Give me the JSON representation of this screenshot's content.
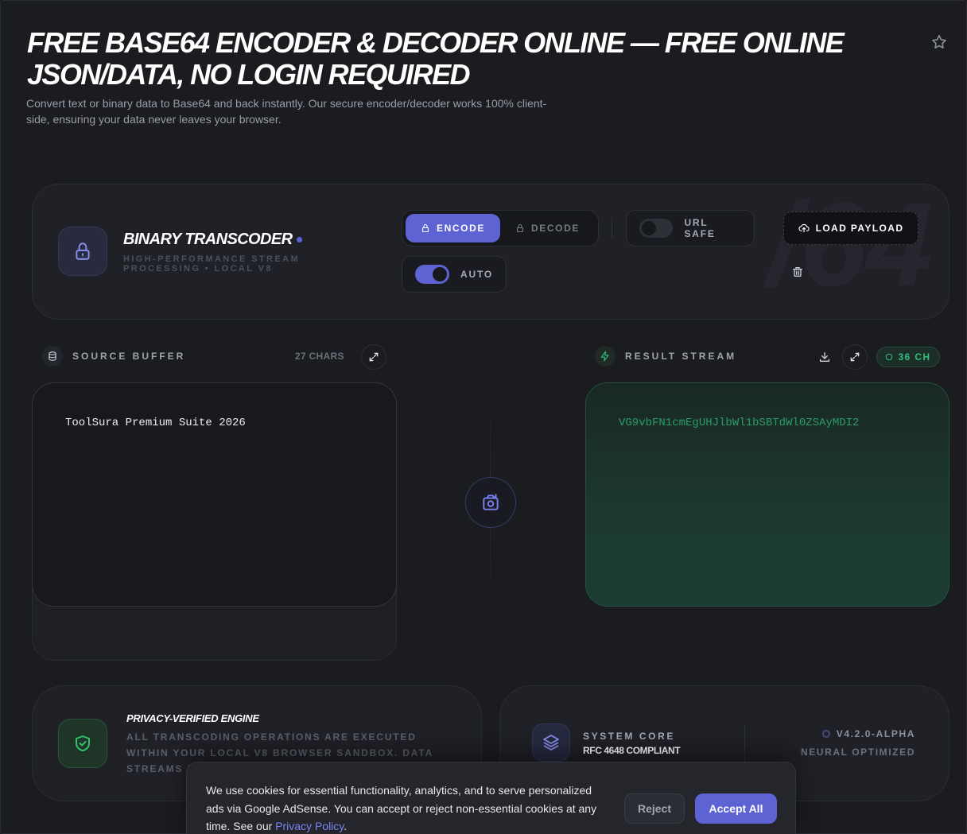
{
  "header": {
    "title": "FREE BASE64 ENCODER & DECODER ONLINE — FREE ONLINE JSON/DATA, NO LOGIN REQUIRED",
    "subtitle": "Convert text or binary data to Base64 and back instantly. Our secure encoder/decoder works 100% client-side, ensuring your data never leaves your browser."
  },
  "control": {
    "watermark": "/64",
    "brand_name": "BINARY TRANSCODER",
    "brand_sub": "HIGH-PERFORMANCE STREAM PROCESSING • LOCAL V8",
    "mode_encode": "ENCODE",
    "mode_decode": "DECODE",
    "active_mode": "ENCODE",
    "url_safe_label": "URL SAFE",
    "url_safe_on": false,
    "auto_label": "AUTO",
    "auto_on": true,
    "load_payload": "LOAD PAYLOAD"
  },
  "source": {
    "label": "SOURCE BUFFER",
    "chars": "27 CHARS",
    "text": "ToolSura Premium Suite 2026"
  },
  "result": {
    "label": "RESULT STREAM",
    "count": "36 CH",
    "text": "VG9vbFN1cmEgUHJlbWl1bSBTdWl0ZSAyMDI2"
  },
  "privacy": {
    "title": "PRIVACY-VERIFIED ENGINE",
    "body": "ALL TRANSCODING OPERATIONS ARE EXECUTED WITHIN YOUR LOCAL V8 BROWSER SANDBOX. DATA STREAMS NEVER INTE"
  },
  "system": {
    "label": "SYSTEM CORE",
    "value": "RFC 4648 COMPLIANT",
    "version": "V4.2.0-ALPHA",
    "neural": "NEURAL OPTIMIZED"
  },
  "cookie": {
    "text": "We use cookies for essential functionality, analytics, and to serve personalized ads via Google AdSense. You can accept or reject non-essential cookies at any time. See our",
    "link": "Privacy Policy",
    "after_link": ".",
    "reject": "Reject",
    "accept": "Accept All"
  },
  "colors": {
    "accent": "#5d63d3",
    "success": "#2fbf7f",
    "background": "#1b1c20"
  },
  "icons": [
    "star-icon",
    "lock-icon",
    "upload-cloud-icon",
    "trash-icon",
    "database-icon",
    "expand-icon",
    "zap-icon",
    "download-icon",
    "swap-icon",
    "shield-check-icon",
    "layers-icon"
  ]
}
